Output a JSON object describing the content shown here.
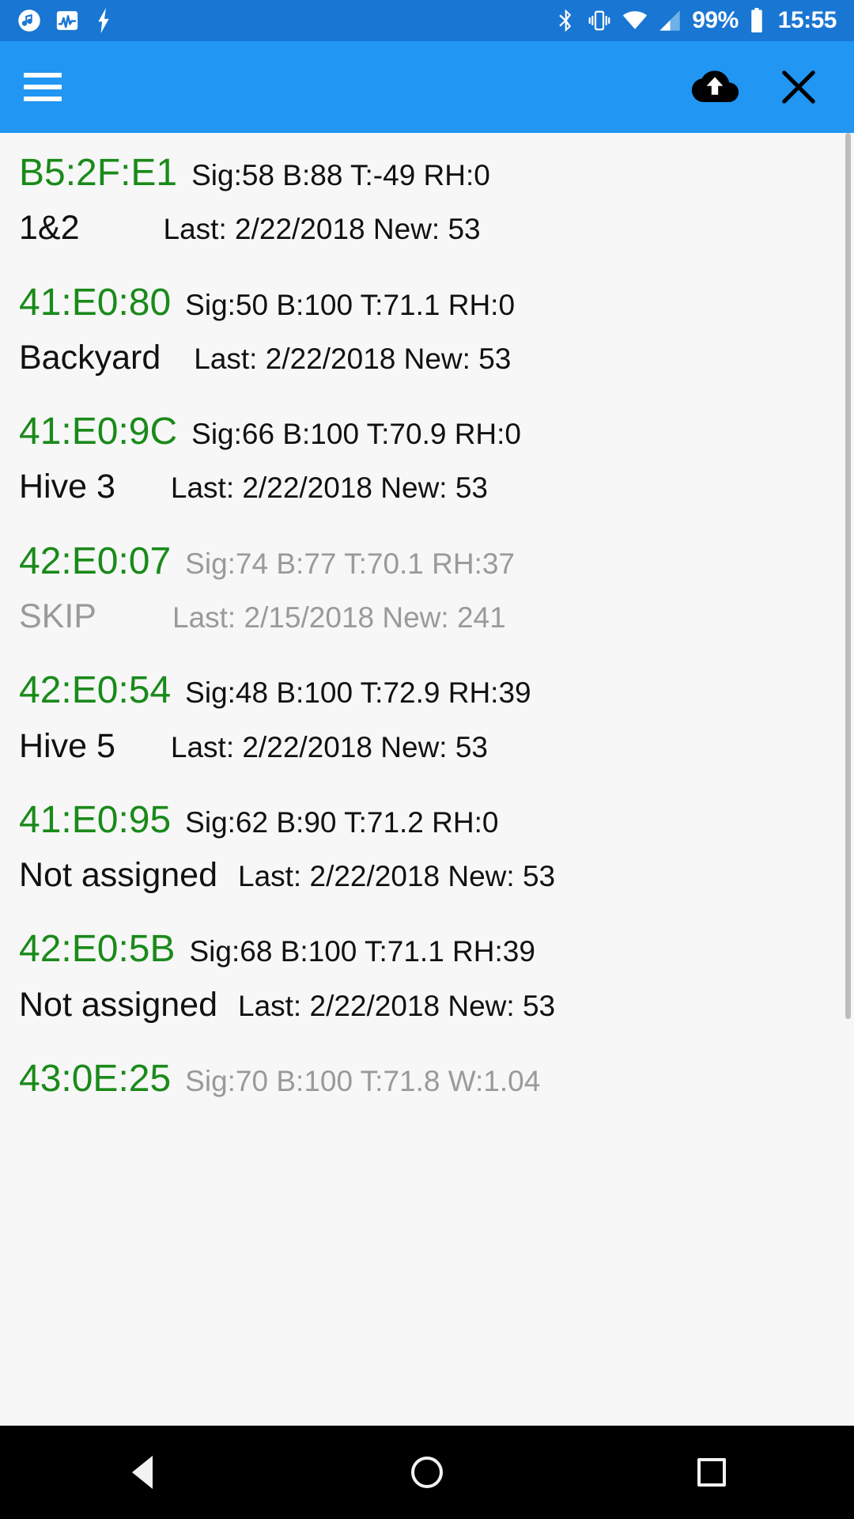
{
  "statusbar": {
    "left_icons": [
      "music-note-icon",
      "activity-graph-icon",
      "lightning-bolt-icon"
    ],
    "right_icons": [
      "bluetooth-icon",
      "vibrate-icon",
      "wifi-icon",
      "cellular-signal-icon"
    ],
    "battery_percent": "99%",
    "battery_icon": "battery-full-icon",
    "clock": "15:55",
    "background": "#1976d2"
  },
  "toolbar": {
    "menu_icon": "hamburger-menu-icon",
    "upload_icon": "cloud-upload-icon",
    "close_icon": "close-x-icon",
    "background": "#2196f3"
  },
  "colors": {
    "device_id": "#1a8a1a",
    "text": "#111111",
    "dimmed": "#9a9a9a",
    "list_background": "#f7f7f7"
  },
  "devices": [
    {
      "id": "B5:2F:E1",
      "stats": "Sig:58  B:88  T:-49  RH:0",
      "name": "1&2",
      "meta": "Last: 2/22/2018  New: 53",
      "dimmed": false
    },
    {
      "id": "41:E0:80",
      "stats": "Sig:50  B:100  T:71.1  RH:0",
      "name": "Backyard",
      "meta": "Last: 2/22/2018  New: 53",
      "dimmed": false
    },
    {
      "id": "41:E0:9C",
      "stats": "Sig:66  B:100  T:70.9  RH:0",
      "name": "Hive 3",
      "meta": "Last: 2/22/2018  New: 53",
      "dimmed": false
    },
    {
      "id": "42:E0:07",
      "stats": "Sig:74  B:77  T:70.1  RH:37",
      "name": "SKIP",
      "meta": "Last: 2/15/2018  New: 241",
      "dimmed": true
    },
    {
      "id": "42:E0:54",
      "stats": "Sig:48  B:100  T:72.9  RH:39",
      "name": "Hive 5",
      "meta": "Last: 2/22/2018  New: 53",
      "dimmed": false
    },
    {
      "id": "41:E0:95",
      "stats": "Sig:62  B:90  T:71.2  RH:0",
      "name": "Not assigned",
      "meta": "Last: 2/22/2018  New: 53",
      "dimmed": false
    },
    {
      "id": "42:E0:5B",
      "stats": "Sig:68  B:100  T:71.1  RH:39",
      "name": "Not assigned",
      "meta": "Last: 2/22/2018  New: 53",
      "dimmed": false
    },
    {
      "id": "43:0E:25",
      "stats": "Sig:70  B:100  T:71.8  W:1.04",
      "name": "",
      "meta": "",
      "dimmed": true
    }
  ],
  "navbar": {
    "back_icon": "back-triangle-icon",
    "home_icon": "home-circle-icon",
    "recents_icon": "recents-square-icon"
  }
}
